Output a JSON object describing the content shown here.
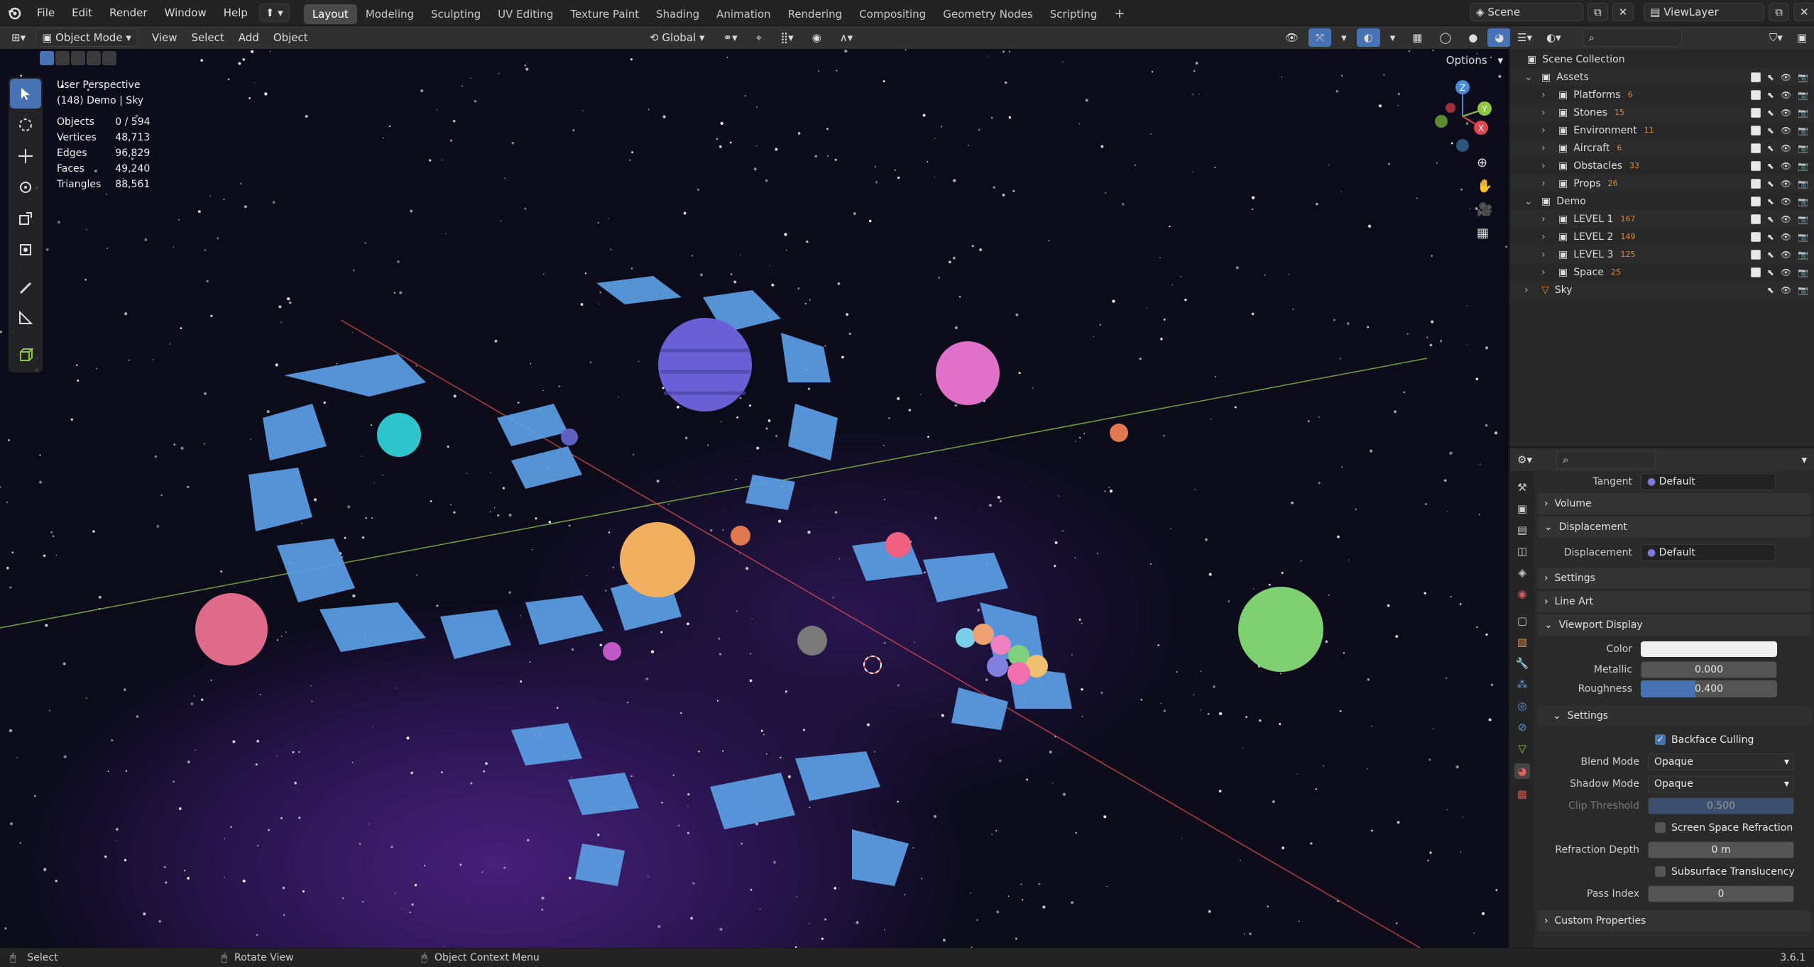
{
  "topbar": {
    "menus": [
      "File",
      "Edit",
      "Render",
      "Window",
      "Help"
    ],
    "workspaces": [
      "Layout",
      "Modeling",
      "Sculpting",
      "UV Editing",
      "Texture Paint",
      "Shading",
      "Animation",
      "Rendering",
      "Compositing",
      "Geometry Nodes",
      "Scripting"
    ],
    "active_workspace": "Layout",
    "scene": "Scene",
    "view_layer": "ViewLayer"
  },
  "viewport_header": {
    "mode": "Object Mode",
    "menus": [
      "View",
      "Select",
      "Add",
      "Object"
    ],
    "orientation": "Global",
    "options": "Options"
  },
  "viewport": {
    "view_name": "User Perspective",
    "collection_info": "(148) Demo | Sky",
    "stats": [
      {
        "label": "Objects",
        "value": "0 / 594"
      },
      {
        "label": "Vertices",
        "value": "48,713"
      },
      {
        "label": "Edges",
        "value": "96,829"
      },
      {
        "label": "Faces",
        "value": "49,240"
      },
      {
        "label": "Triangles",
        "value": "88,561"
      }
    ],
    "gizmo_axes": [
      "X",
      "Y",
      "Z"
    ]
  },
  "outliner": {
    "root": "Scene Collection",
    "items": [
      {
        "label": "Assets",
        "level": 1,
        "count": ""
      },
      {
        "label": "Platforms",
        "level": 2,
        "count": "6"
      },
      {
        "label": "Stones",
        "level": 2,
        "count": "15"
      },
      {
        "label": "Environment",
        "level": 2,
        "count": "11"
      },
      {
        "label": "Aircraft",
        "level": 2,
        "count": "6"
      },
      {
        "label": "Obstacles",
        "level": 2,
        "count": "33"
      },
      {
        "label": "Props",
        "level": 2,
        "count": "26"
      },
      {
        "label": "Demo",
        "level": 1,
        "count": ""
      },
      {
        "label": "LEVEL 1",
        "level": 2,
        "count": "167"
      },
      {
        "label": "LEVEL 2",
        "level": 2,
        "count": "149"
      },
      {
        "label": "LEVEL 3",
        "level": 2,
        "count": "125"
      },
      {
        "label": "Space",
        "level": 2,
        "count": "25"
      },
      {
        "label": "Sky",
        "level": 1,
        "count": ""
      }
    ]
  },
  "properties": {
    "tangent_label": "Tangent",
    "tangent_value": "Default",
    "volume": "Volume",
    "displacement_panel": "Displacement",
    "displacement_label": "Displacement",
    "displacement_value": "Default",
    "settings_panel": "Settings",
    "line_art": "Line Art",
    "viewport_display": "Viewport Display",
    "color_label": "Color",
    "metallic_label": "Metallic",
    "metallic_value": "0.000",
    "roughness_label": "Roughness",
    "roughness_value": "0.400",
    "roughness_fraction": 0.4,
    "settings_sub": "Settings",
    "backface_culling": "Backface Culling",
    "blend_mode_label": "Blend Mode",
    "blend_mode_value": "Opaque",
    "shadow_mode_label": "Shadow Mode",
    "shadow_mode_value": "Opaque",
    "clip_threshold_label": "Clip Threshold",
    "clip_threshold_value": "0.500",
    "ssr": "Screen Space Refraction",
    "refraction_depth_label": "Refraction Depth",
    "refraction_depth_value": "0 m",
    "subsurface": "Subsurface Translucency",
    "pass_index_label": "Pass Index",
    "pass_index_value": "0",
    "custom_properties": "Custom Properties"
  },
  "statusbar": {
    "select": "Select",
    "rotate": "Rotate View",
    "context": "Object Context Menu",
    "version": "3.6.1"
  },
  "colors": {
    "accent": "#4772b3",
    "x_axis": "#e0474f",
    "y_axis": "#8ec63f",
    "z_axis": "#4b8ad6",
    "count_badge": "#e08a3c"
  }
}
